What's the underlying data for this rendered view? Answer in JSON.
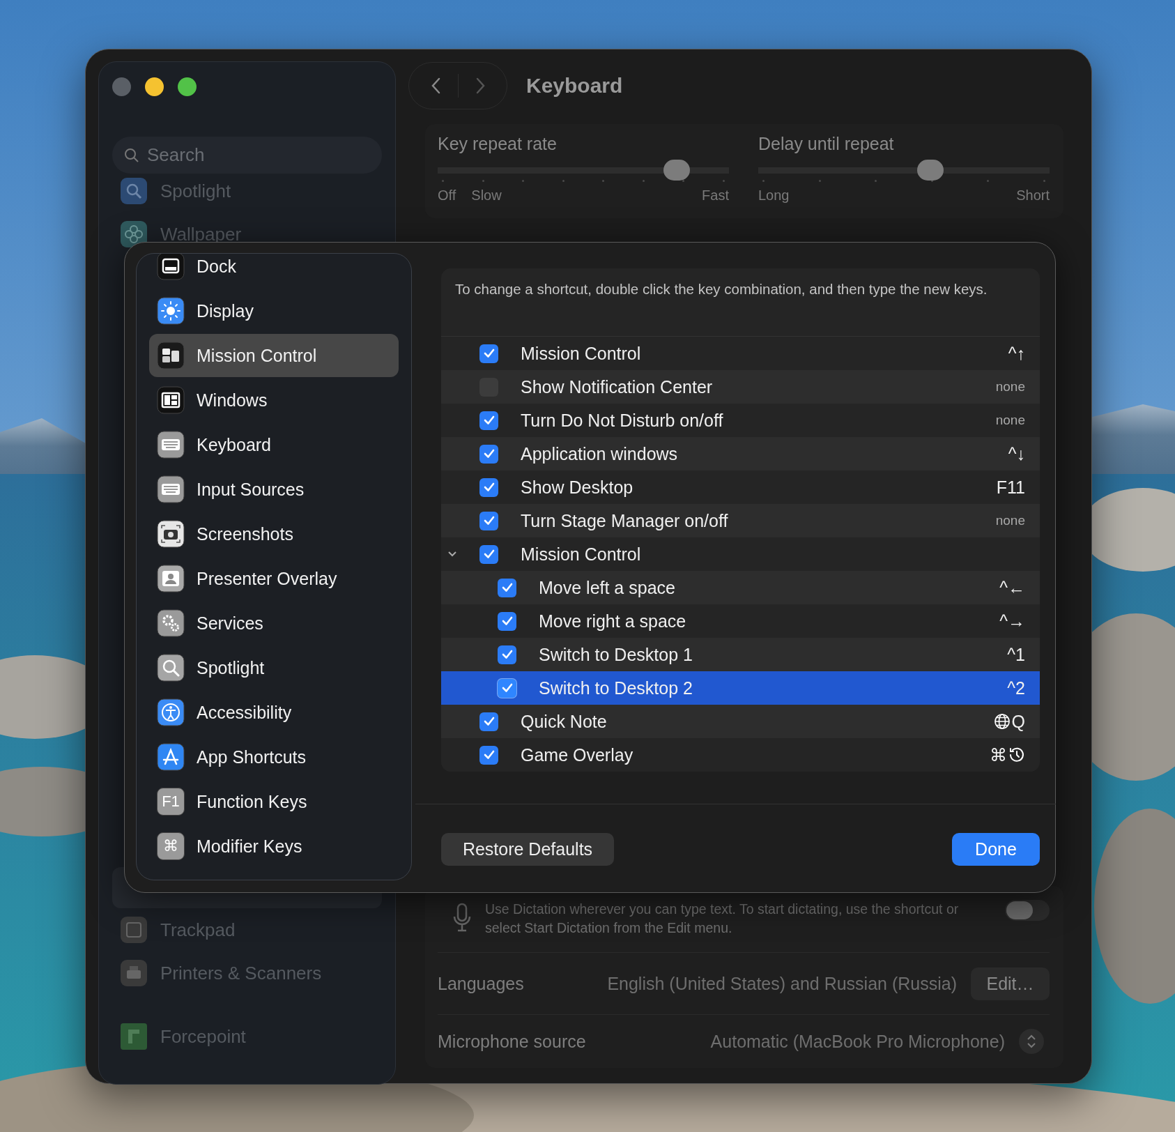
{
  "window": {
    "title": "Keyboard"
  },
  "sidebar": {
    "search": {
      "placeholder": "Search"
    },
    "items": [
      {
        "label": "Spotlight"
      },
      {
        "label": "Wallpaper"
      }
    ],
    "items_below": [
      {
        "label": "Trackpad"
      },
      {
        "label": "Printers & Scanners"
      },
      {
        "label": "Forcepoint"
      }
    ]
  },
  "sliders": [
    {
      "label": "Key repeat rate",
      "level": 0.82,
      "scale": [
        "Off",
        "Slow",
        "Fast"
      ]
    },
    {
      "label": "Delay until repeat",
      "level": 0.59,
      "scale": [
        "Long",
        "Short"
      ]
    }
  ],
  "sheet": {
    "sidebar_items": [
      {
        "label": "Dock",
        "selected": false
      },
      {
        "label": "Display",
        "selected": false
      },
      {
        "label": "Mission Control",
        "selected": true
      },
      {
        "label": "Windows",
        "selected": false
      },
      {
        "label": "Keyboard",
        "selected": false
      },
      {
        "label": "Input Sources",
        "selected": false
      },
      {
        "label": "Screenshots",
        "selected": false
      },
      {
        "label": "Presenter Overlay",
        "selected": false
      },
      {
        "label": "Services",
        "selected": false
      },
      {
        "label": "Spotlight",
        "selected": false
      },
      {
        "label": "Accessibility",
        "selected": false
      },
      {
        "label": "App Shortcuts",
        "selected": false
      },
      {
        "label": "Function Keys",
        "selected": false,
        "icon_text": "F1"
      },
      {
        "label": "Modifier Keys",
        "selected": false,
        "icon_text": "⌘"
      }
    ],
    "description": "To change a shortcut, double click the key combination, and then type the new keys.",
    "shortcuts": [
      {
        "label": "Mission Control",
        "checked": true,
        "selected": false,
        "keys": "^↑",
        "unassigned": false
      },
      {
        "label": "Show Notification Center",
        "checked": false,
        "selected": false,
        "keys": "none",
        "unassigned": true
      },
      {
        "label": "Turn Do Not Disturb on/off",
        "checked": true,
        "selected": false,
        "keys": "none",
        "unassigned": true
      },
      {
        "label": "Application windows",
        "checked": true,
        "selected": false,
        "keys": "^↓",
        "unassigned": false
      },
      {
        "label": "Show Desktop",
        "checked": true,
        "selected": false,
        "keys": "F11",
        "unassigned": false
      },
      {
        "label": "Turn Stage Manager on/off",
        "checked": true,
        "selected": false,
        "keys": "none",
        "unassigned": true
      },
      {
        "label": "Mission Control",
        "checked": true,
        "selected": false,
        "expanded": true,
        "children": [
          {
            "label": "Move left a space",
            "checked": true,
            "selected": false,
            "keys": "^←",
            "unassigned": false
          },
          {
            "label": "Move right a space",
            "checked": true,
            "selected": false,
            "keys": "^→",
            "unassigned": false
          },
          {
            "label": "Switch to Desktop 1",
            "checked": true,
            "selected": false,
            "keys": "^1",
            "unassigned": false
          },
          {
            "label": "Switch to Desktop 2",
            "checked": true,
            "selected": true,
            "keys": "^2",
            "unassigned": false
          }
        ]
      },
      {
        "label": "Quick Note",
        "checked": true,
        "selected": false,
        "keys": "Q",
        "kind": "prefixed",
        "unassigned": false
      },
      {
        "label": "Game Overlay",
        "checked": true,
        "selected": false,
        "keys": "⌘",
        "kind": "suffixed",
        "unassigned": false
      }
    ],
    "buttons": [
      {
        "label": "Restore Defaults",
        "kind": "secondary"
      },
      {
        "label": "Done",
        "kind": "primary"
      }
    ]
  },
  "dictation": {
    "text": "Use Dictation wherever you can type text. To start dictating, use the shortcut or select Start Dictation from the Edit menu.",
    "on": false
  },
  "languages": {
    "label": "Languages",
    "value": "English (United States) and Russian (Russia)",
    "button": "Edit…"
  },
  "microphone": {
    "label": "Microphone source",
    "value": "Automatic (MacBook Pro Microphone)"
  }
}
